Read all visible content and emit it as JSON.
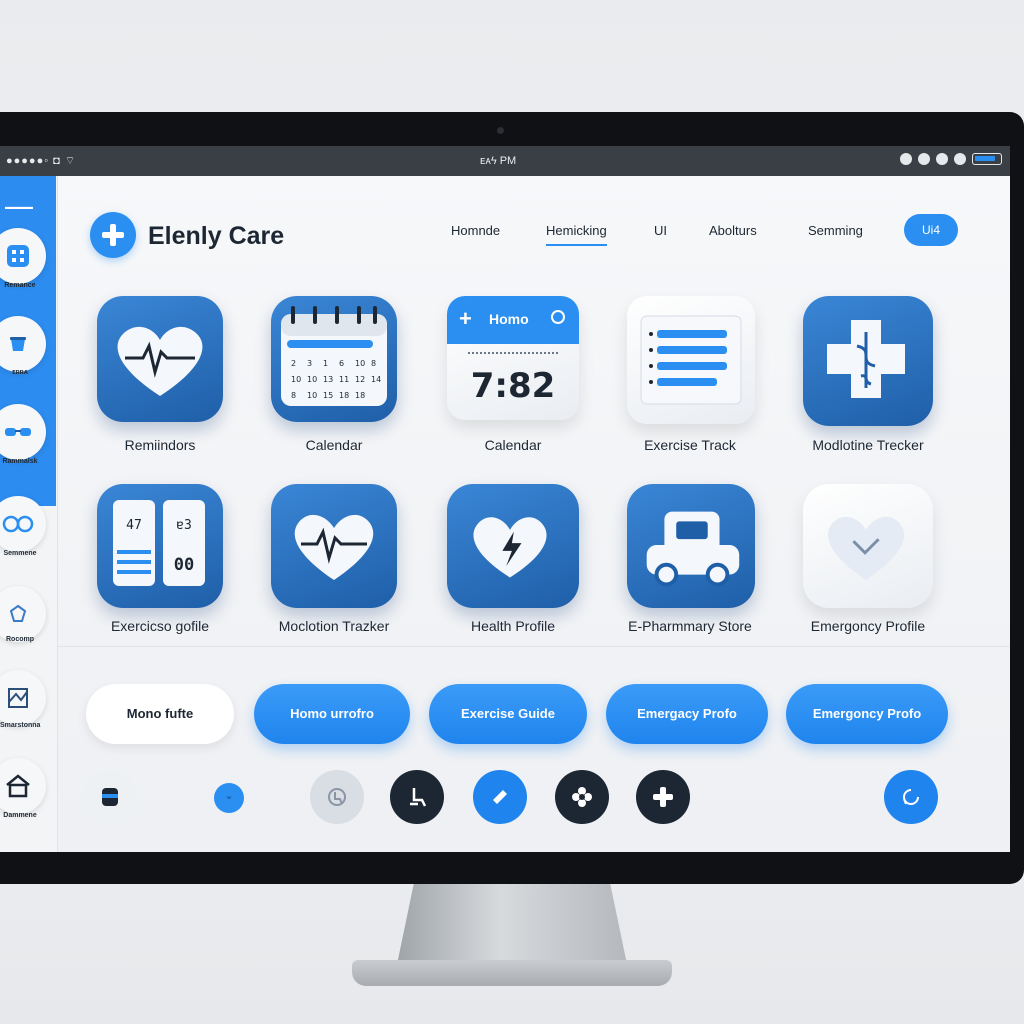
{
  "statusbar": {
    "left_text": "●●●●●◦ ◘ ⌔",
    "time": "ᴇᴀϟ PM",
    "right_text": "◦ ◦ ◎ ◉ ◉ ◦ɢ ◦ɢ◦"
  },
  "sidebar": {
    "top_label": "▬▬▬▬",
    "items": [
      {
        "label": "Remance",
        "icon": "grid-icon"
      },
      {
        "label": "ᴇʀʀᴀ",
        "icon": "cup-icon"
      },
      {
        "label": "Rammalsk",
        "icon": "glasses-icon"
      },
      {
        "label": "Semmene",
        "icon": "rings-icon"
      },
      {
        "label": "Rocomp",
        "icon": "shield-icon"
      },
      {
        "label": "Smarstonna",
        "icon": "map-icon"
      },
      {
        "label": "Dammene",
        "icon": "home-icon"
      }
    ]
  },
  "header": {
    "title": "Elenly Care",
    "nav": [
      "Homnde",
      "Hemicking",
      "UI",
      "Abolturs",
      "Semming"
    ],
    "active_nav": "Hemicking",
    "nav_button": "Ui4"
  },
  "tiles": {
    "row1": [
      {
        "label": "Remiindors",
        "icon": "heart-pulse-icon",
        "style": "blue"
      },
      {
        "label": "Calendar",
        "icon": "calendar-icon",
        "style": "blue"
      },
      {
        "label": "Calendar",
        "icon": "clock-widget-icon",
        "style": "white",
        "widget_header": "Homo",
        "widget_time": "7:82"
      },
      {
        "label": "Exercise Track",
        "icon": "checklist-icon",
        "style": "white"
      },
      {
        "label": "Modlotine Trecker",
        "icon": "medical-cross-icon",
        "style": "blue"
      }
    ],
    "row2": [
      {
        "label": "Exercicso gofile",
        "icon": "counter-icon",
        "style": "blue",
        "counter_left": "47",
        "counter_right_top": "ɐ3",
        "counter_right_bottom": "00"
      },
      {
        "label": "Moclotion Trazker",
        "icon": "heart-pulse-icon",
        "style": "blue"
      },
      {
        "label": "Health Profile",
        "icon": "heart-bolt-icon",
        "style": "blue"
      },
      {
        "label": "E-Pharmmary Store",
        "icon": "vehicle-icon",
        "style": "blue"
      },
      {
        "label": "Emergoncy Profile",
        "icon": "heart-check-icon",
        "style": "white"
      }
    ]
  },
  "buttons": [
    {
      "label": "Mono fufte",
      "style": "white"
    },
    {
      "label": "Homo urrofro",
      "style": "blue"
    },
    {
      "label": "Exercise Guide",
      "style": "blue"
    },
    {
      "label": "Emergacy Profo",
      "style": "blue"
    },
    {
      "label": "Emergoncy Profo",
      "style": "blue"
    }
  ],
  "dock": [
    {
      "icon": "badge-icon"
    },
    {
      "icon": "dot-icon"
    },
    {
      "icon": "accessibility-icon"
    },
    {
      "icon": "wheelchair-icon"
    },
    {
      "icon": "megaphone-icon"
    },
    {
      "icon": "flower-icon"
    },
    {
      "icon": "plus-icon"
    },
    {
      "icon": "refresh-icon"
    }
  ],
  "colors": {
    "accent": "#2b8ff2",
    "tile_blue": "#2a6fbf",
    "text_dark": "#1d2733"
  }
}
